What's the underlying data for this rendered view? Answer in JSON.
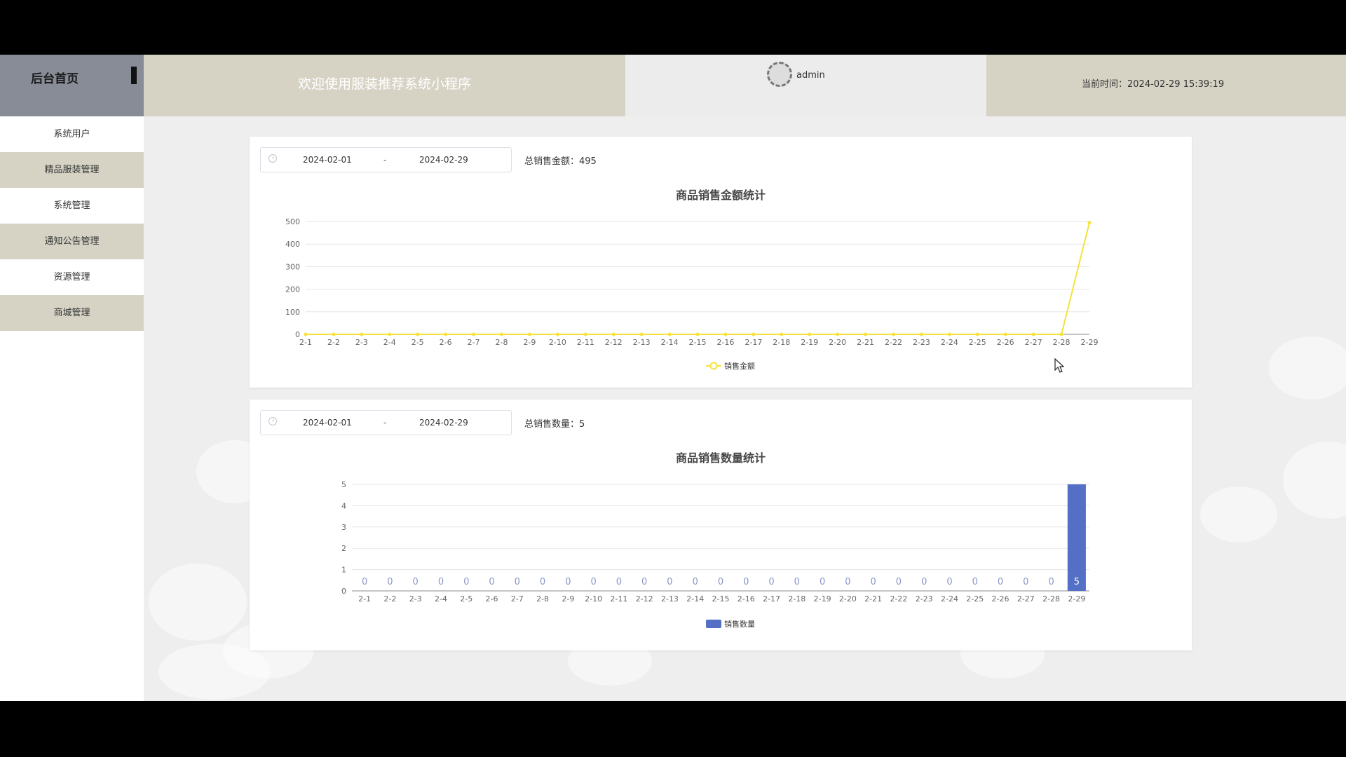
{
  "header": {
    "logo_title": "后台首页",
    "welcome": "欢迎使用服装推荐系统小程序",
    "user_name": "admin",
    "time_label": "当前时间：",
    "time_value": "2024-02-29 15:39:19"
  },
  "sidebar": {
    "items": [
      {
        "label": "系统用户"
      },
      {
        "label": "精品服装管理"
      },
      {
        "label": "系统管理"
      },
      {
        "label": "通知公告管理"
      },
      {
        "label": "资源管理"
      },
      {
        "label": "商城管理"
      }
    ]
  },
  "sales_amount": {
    "start_date": "2024-02-01",
    "separator": "-",
    "end_date": "2024-02-29",
    "total_label": "总销售金额：",
    "total_value": "495"
  },
  "sales_quantity": {
    "start_date": "2024-02-01",
    "separator": "-",
    "end_date": "2024-02-29",
    "total_label": "总销售数量：",
    "total_value": "5"
  },
  "colors": {
    "header_accent": "#d6d3c5",
    "logo_bg": "#888c97",
    "line_series": "#f5e33b",
    "bar_series": "#5470c6"
  },
  "chart_data": [
    {
      "type": "line",
      "title": "商品销售金额统计",
      "categories": [
        "2-1",
        "2-2",
        "2-3",
        "2-4",
        "2-5",
        "2-6",
        "2-7",
        "2-8",
        "2-9",
        "2-10",
        "2-11",
        "2-12",
        "2-13",
        "2-14",
        "2-15",
        "2-16",
        "2-17",
        "2-18",
        "2-19",
        "2-20",
        "2-21",
        "2-22",
        "2-23",
        "2-24",
        "2-25",
        "2-26",
        "2-27",
        "2-28",
        "2-29"
      ],
      "series": [
        {
          "name": "销售金额",
          "values": [
            0,
            0,
            0,
            0,
            0,
            0,
            0,
            0,
            0,
            0,
            0,
            0,
            0,
            0,
            0,
            0,
            0,
            0,
            0,
            0,
            0,
            0,
            0,
            0,
            0,
            0,
            0,
            0,
            495
          ]
        }
      ],
      "yticks": [
        0,
        100,
        200,
        300,
        400,
        500
      ],
      "ylim": [
        0,
        500
      ],
      "grid": true,
      "legend": "bottom-center"
    },
    {
      "type": "bar",
      "title": "商品销售数量统计",
      "categories": [
        "2-1",
        "2-2",
        "2-3",
        "2-4",
        "2-5",
        "2-6",
        "2-7",
        "2-8",
        "2-9",
        "2-10",
        "2-11",
        "2-12",
        "2-13",
        "2-14",
        "2-15",
        "2-16",
        "2-17",
        "2-18",
        "2-19",
        "2-20",
        "2-21",
        "2-22",
        "2-23",
        "2-24",
        "2-25",
        "2-26",
        "2-27",
        "2-28",
        "2-29"
      ],
      "series": [
        {
          "name": "销售数量",
          "values": [
            0,
            0,
            0,
            0,
            0,
            0,
            0,
            0,
            0,
            0,
            0,
            0,
            0,
            0,
            0,
            0,
            0,
            0,
            0,
            0,
            0,
            0,
            0,
            0,
            0,
            0,
            0,
            0,
            5
          ]
        }
      ],
      "yticks": [
        0,
        1,
        2,
        3,
        4,
        5
      ],
      "ylim": [
        0,
        5
      ],
      "grid": true,
      "legend": "bottom-center"
    }
  ]
}
